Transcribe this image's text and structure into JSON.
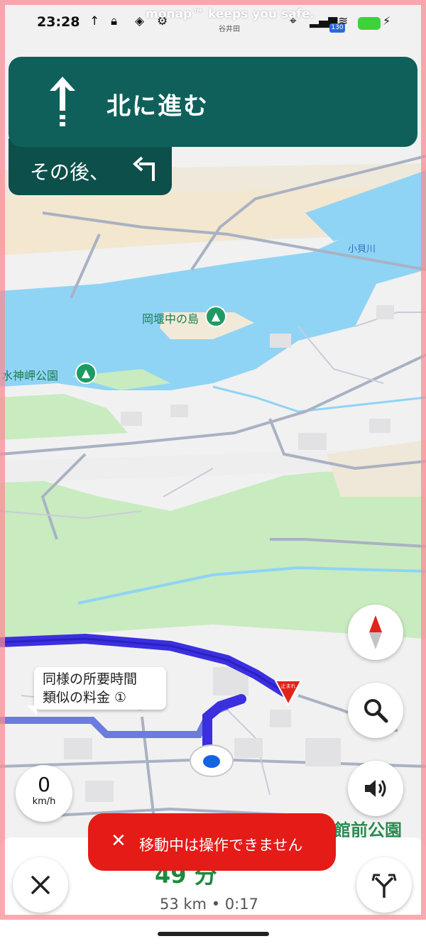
{
  "status_bar": {
    "time": "23:28",
    "notice": "monap™ keeps you safe.",
    "place": "谷井田",
    "network_badge": "130"
  },
  "navigation": {
    "instruction": "北に進む",
    "then_label": "その後、",
    "speed_value": "0",
    "speed_unit": "km/h",
    "eta_big": "49 分",
    "distance_time": "53 km • 0:17"
  },
  "map": {
    "labels": {
      "island": "岡堰中の島",
      "park": "水神岬公園",
      "river": "小貝川",
      "destination": "館前公園"
    },
    "callout": {
      "line1": "同様の所要時間",
      "line2": "類似の料金 ①"
    },
    "stop_sign_text": "止まれ"
  },
  "toast": {
    "message": "移動中は操作できません"
  },
  "colors": {
    "card": "#0f605a",
    "route": "#3b2fe0",
    "water": "#8fd4f5",
    "park": "#c9ebc0",
    "toast": "#e41b17",
    "eta": "#1c8a3c"
  },
  "icons": [
    "compass-icon",
    "search-icon",
    "volume-icon",
    "close-icon",
    "route-options-icon",
    "arrow-up-icon",
    "turn-left-icon"
  ]
}
